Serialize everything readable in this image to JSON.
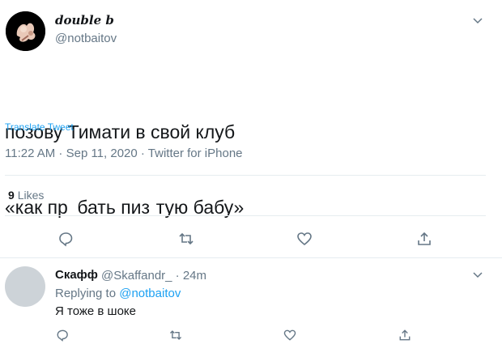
{
  "tweet": {
    "author": {
      "display_name": "double b",
      "handle": "@notbaitov"
    },
    "text_line1": "позову Тимати в свой клуб",
    "text_line2": "«как пр      бать пиз    тую бабу»",
    "translate_label": "Translate Tweet",
    "timestamp": "11:22 AM · Sep 11, 2020 · Twitter for iPhone",
    "likes_count": "9",
    "likes_label": "Likes",
    "actions": [
      "reply-icon",
      "retweet-icon",
      "like-icon",
      "share-icon"
    ]
  },
  "reply": {
    "display_name": "Скафф",
    "handle_time": "@Skaffandr_ · 24m",
    "replying_prefix": "Replying to",
    "replying_mention": "@notbaitov",
    "text": "Я тоже в шоке",
    "actions": [
      "reply-icon",
      "retweet-icon",
      "like-icon",
      "share-icon"
    ]
  },
  "colors": {
    "accent": "#1da1f2",
    "secondary_text": "#657786",
    "primary_text": "#14171a",
    "divider": "#e6ecf0"
  }
}
